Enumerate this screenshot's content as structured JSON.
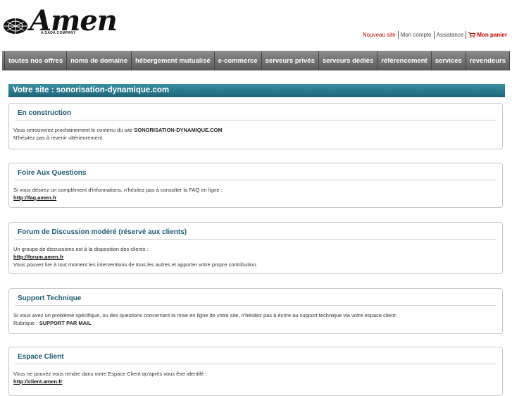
{
  "header": {
    "logo_text": "Amen",
    "logo_sub": "A DADA COMPANY",
    "links": {
      "new_site": "Nouveau site",
      "account": "Mon compte",
      "help": "Assistance",
      "cart": "Mon panier"
    }
  },
  "nav": {
    "items": [
      "toutes nos offres",
      "noms de domaine",
      "hébergement mutualisé",
      "e-commerce",
      "serveurs privés",
      "serveurs dédiés",
      "référencement",
      "services",
      "revendeurs"
    ]
  },
  "site_bar": "Votre site : sonorisation-dynamique.com",
  "sections": {
    "construction": {
      "title": "En construction",
      "line1_prefix": "Vous retrouverez prochainement le contenu du site ",
      "line1_site": "SONORISATION-DYNAMIQUE.COM",
      "line2": "N'hésitez pas à revenir ultérieurement."
    },
    "faq": {
      "title": "Foire Aux Questions",
      "line1": "Si vous désirez un complément d'informations, n'hésitez pas à consulter la FAQ en ligne :",
      "link": "http://faq.amen.fr"
    },
    "forum": {
      "title": "Forum de Discussion modéré (réservé aux clients)",
      "line1": "Un groupe de discussions est à la disposition des clients :",
      "link": "http://forum.amen.fr",
      "line2": "Vous pouvez lire à tout moment les interventions de tous les autres et apporter votre propre contribution."
    },
    "support": {
      "title": "Support Technique",
      "line1": "Si vous avez un problème spécifique, ou des questions concernant la mise en ligne de votre site, n'hésitez pas à écrire au support technique via votre espace client:",
      "line2_prefix": "Rubrique : ",
      "line2_bold": "SUPPORT PAR MAIL"
    },
    "client": {
      "title": "Espace Client",
      "line1": "Vous ne pouvez vous rendre dans votre Espace Client qu'après vous être identifé :",
      "link": "http://client.amen.fr"
    }
  },
  "colors": {
    "nav_bg": "#6e6e6e",
    "site_bar_bg": "#2b7a8d",
    "heading": "#1d5c73",
    "link_red": "#c40000"
  }
}
